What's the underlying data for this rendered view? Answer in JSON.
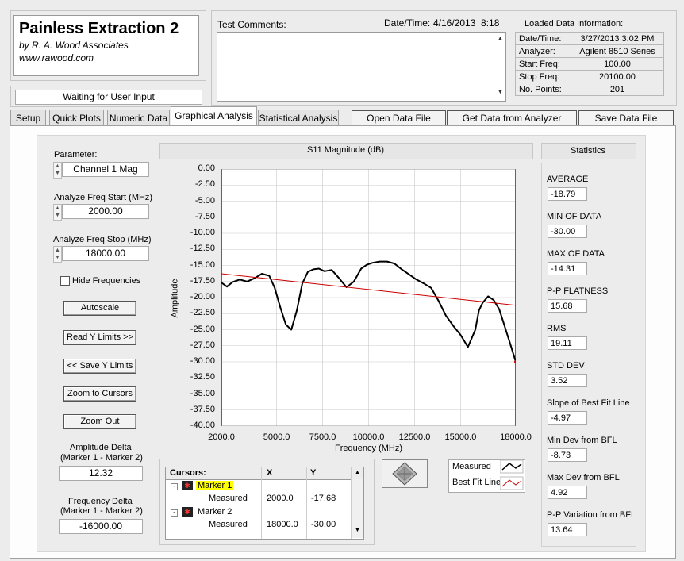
{
  "branding": {
    "app_title": "Painless Extraction 2",
    "author": "by R. A. Wood Associates",
    "website": "www.rawood.com"
  },
  "status": "Waiting for User Input",
  "test_comments": {
    "label": "Test Comments:",
    "value": ""
  },
  "datetime": {
    "label": "Date/Time:",
    "value": "4/16/2013  8:18"
  },
  "loaded_data": {
    "title": "Loaded Data Information:",
    "rows": [
      {
        "label": "Date/Time:",
        "value": "3/27/2013 3:02 PM"
      },
      {
        "label": "Analyzer:",
        "value": "Agilent 8510 Series"
      },
      {
        "label": "Start Freq:",
        "value": "100.00"
      },
      {
        "label": "Stop Freq:",
        "value": "20100.00"
      },
      {
        "label": "No. Points:",
        "value": "201"
      }
    ]
  },
  "tabs": [
    "Setup",
    "Quick Plots",
    "Numeric Data",
    "Graphical Analysis",
    "Statistical Analysis"
  ],
  "active_tab": "Graphical Analysis",
  "file_buttons": {
    "open": "Open Data File",
    "get": "Get Data from Analyzer",
    "save": "Save Data File"
  },
  "controls": {
    "parameter_label": "Parameter:",
    "parameter_value": "Channel 1 Mag",
    "freq_start_label": "Analyze Freq Start (MHz)",
    "freq_start_value": "2000.00",
    "freq_stop_label": "Analyze Freq Stop (MHz)",
    "freq_stop_value": "18000.00",
    "hide_freq_label": "Hide Frequencies",
    "autoscale": "Autoscale",
    "read_y": "Read Y Limits >>",
    "save_y": "<< Save Y Limits",
    "zoom_cursors": "Zoom to Cursors",
    "zoom_out": "Zoom Out",
    "amp_delta_label1": "Amplitude Delta",
    "amp_delta_label2": "(Marker 1 - Marker 2)",
    "amp_delta_value": "12.32",
    "freq_delta_label1": "Frequency Delta",
    "freq_delta_label2": "(Marker 1 - Marker 2)",
    "freq_delta_value": "-16000.00"
  },
  "cursors": {
    "headers": [
      "Cursors:",
      "X",
      "Y"
    ],
    "marker1": "Marker 1",
    "marker2": "Marker 2",
    "measured": "Measured",
    "m1_x": "2000.0",
    "m1_y": "-17.68",
    "m2_x": "18000.0",
    "m2_y": "-30.00"
  },
  "legend": {
    "measured": "Measured",
    "bfl": "Best Fit Line"
  },
  "statistics": {
    "title": "Statistics",
    "items": [
      {
        "label": "AVERAGE",
        "value": "-18.79"
      },
      {
        "label": "MIN OF DATA",
        "value": "-30.00"
      },
      {
        "label": "MAX OF DATA",
        "value": "-14.31"
      },
      {
        "label": "P-P FLATNESS",
        "value": "15.68"
      },
      {
        "label": "RMS",
        "value": "19.11"
      },
      {
        "label": "STD DEV",
        "value": "3.52"
      },
      {
        "label": "Slope of Best Fit Line",
        "value": "-4.97"
      },
      {
        "label": "Min Dev from BFL",
        "value": "-8.73"
      },
      {
        "label": "Max Dev from BFL",
        "value": "4.92"
      },
      {
        "label": "P-P Variation from BFL",
        "value": "13.64"
      }
    ]
  },
  "chart_data": {
    "type": "line",
    "title": "S11 Magnitude (dB)",
    "xlabel": "Frequency (MHz)",
    "ylabel": "Amplitude",
    "xlim": [
      2000,
      18000
    ],
    "ylim": [
      -40,
      0
    ],
    "x_tick_labels": [
      "2000.0",
      "5000.0",
      "7500.0",
      "10000.0",
      "12500.0",
      "15000.0",
      "18000.0"
    ],
    "x_ticks": [
      2000,
      5000,
      7500,
      10000,
      12500,
      15000,
      18000
    ],
    "y_tick_labels": [
      "0.00",
      "-2.50",
      "-5.00",
      "-7.50",
      "-10.00",
      "-12.50",
      "-15.00",
      "-17.50",
      "-20.00",
      "-22.50",
      "-25.00",
      "-27.50",
      "-30.00",
      "-32.50",
      "-35.00",
      "-37.50",
      "-40.00"
    ],
    "grid": true,
    "series": [
      {
        "name": "Measured",
        "color": "#000000",
        "x": [
          2000,
          2300,
          2600,
          3000,
          3400,
          3800,
          4200,
          4600,
          4900,
          5200,
          5500,
          5800,
          6100,
          6400,
          6700,
          7000,
          7300,
          7600,
          8000,
          8400,
          8800,
          9200,
          9600,
          9900,
          10200,
          10600,
          11000,
          11400,
          11800,
          12200,
          12600,
          13000,
          13400,
          13800,
          14200,
          14600,
          15000,
          15400,
          15800,
          16000,
          16200,
          16500,
          16800,
          17100,
          17400,
          17700,
          18000
        ],
        "y": [
          -17.68,
          -18.3,
          -17.6,
          -17.2,
          -17.5,
          -17.0,
          -16.3,
          -16.6,
          -18.5,
          -21.5,
          -24.2,
          -25.0,
          -22.0,
          -17.8,
          -16.0,
          -15.6,
          -15.5,
          -15.9,
          -15.7,
          -17.0,
          -18.4,
          -17.5,
          -15.5,
          -14.9,
          -14.6,
          -14.4,
          -14.4,
          -14.7,
          -15.6,
          -16.4,
          -17.2,
          -17.8,
          -18.5,
          -20.5,
          -22.8,
          -24.4,
          -25.8,
          -27.7,
          -25.0,
          -22.0,
          -20.8,
          -19.8,
          -20.4,
          -21.8,
          -24.5,
          -27.2,
          -30.0
        ]
      },
      {
        "name": "Best Fit Line",
        "color": "#cc0000",
        "x": [
          2000,
          18000
        ],
        "y": [
          -16.3,
          -21.2
        ]
      }
    ]
  },
  "colors": {
    "marker_highlight": "#ffff00",
    "bfl": "#cc0000",
    "plot_border": "#ff0000"
  }
}
